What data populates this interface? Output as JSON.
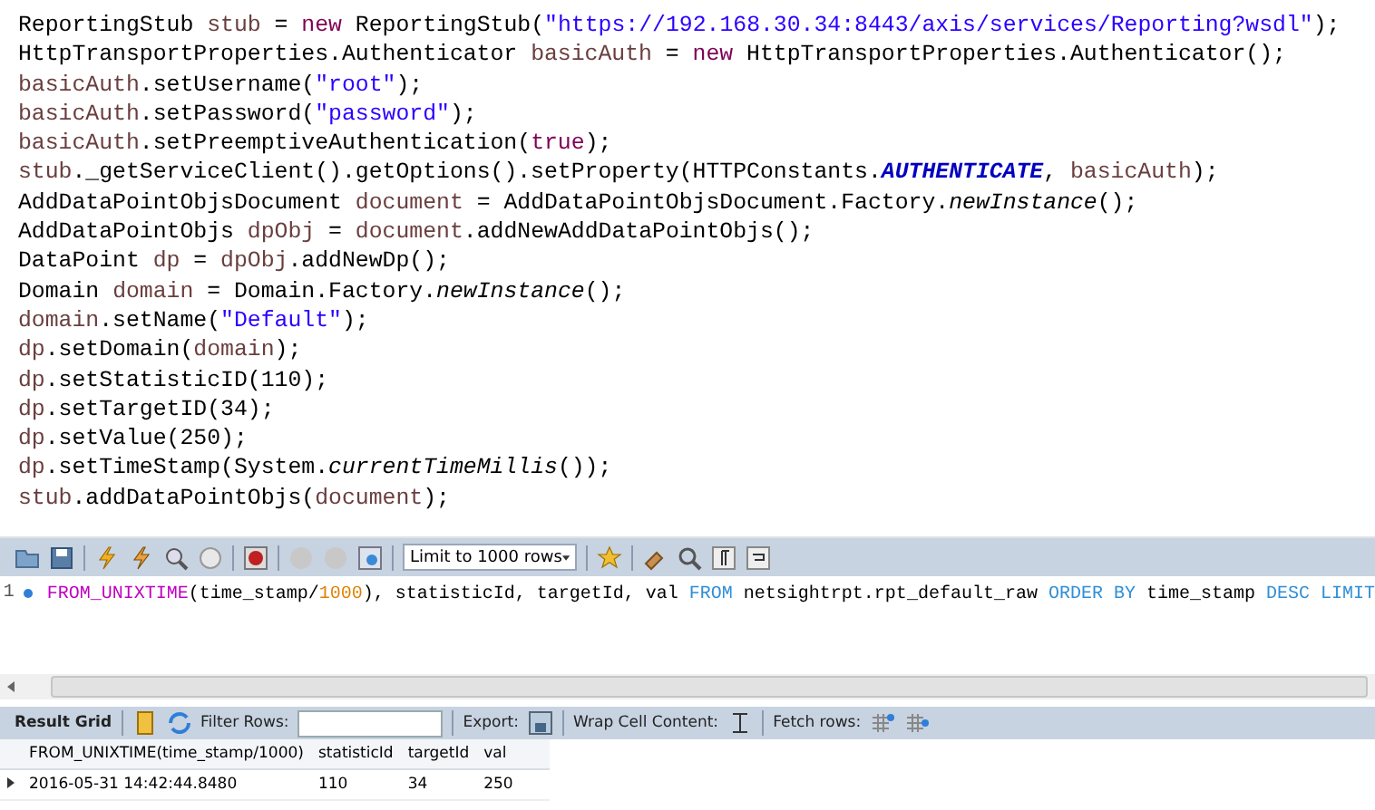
{
  "code_editor": {
    "lines": [
      [
        {
          "kind": "p",
          "text": "ReportingStub "
        },
        {
          "kind": "v",
          "text": "stub"
        },
        {
          "kind": "p",
          "text": " = "
        },
        {
          "kind": "k",
          "text": "new"
        },
        {
          "kind": "p",
          "text": " ReportingStub("
        },
        {
          "kind": "s",
          "text": "\"https://192.168.30.34:8443/axis/services/Reporting?wsdl\""
        },
        {
          "kind": "p",
          "text": ");"
        }
      ],
      [
        {
          "kind": "p",
          "text": "HttpTransportProperties.Authenticator "
        },
        {
          "kind": "v",
          "text": "basicAuth"
        },
        {
          "kind": "p",
          "text": " = "
        },
        {
          "kind": "k",
          "text": "new"
        },
        {
          "kind": "p",
          "text": " HttpTransportProperties.Authenticator();"
        }
      ],
      [
        {
          "kind": "v",
          "text": "basicAuth"
        },
        {
          "kind": "p",
          "text": ".setUsername("
        },
        {
          "kind": "s",
          "text": "\"root\""
        },
        {
          "kind": "p",
          "text": ");"
        }
      ],
      [
        {
          "kind": "v",
          "text": "basicAuth"
        },
        {
          "kind": "p",
          "text": ".setPassword("
        },
        {
          "kind": "s",
          "text": "\"password\""
        },
        {
          "kind": "p",
          "text": ");"
        }
      ],
      [
        {
          "kind": "v",
          "text": "basicAuth"
        },
        {
          "kind": "p",
          "text": ".setPreemptiveAuthentication("
        },
        {
          "kind": "k",
          "text": "true"
        },
        {
          "kind": "p",
          "text": ");"
        }
      ],
      [
        {
          "kind": "v",
          "text": "stub"
        },
        {
          "kind": "p",
          "text": "._getServiceClient().getOptions().setProperty(HTTPConstants."
        },
        {
          "kind": "c",
          "text": "AUTHENTICATE"
        },
        {
          "kind": "p",
          "text": ", "
        },
        {
          "kind": "v",
          "text": "basicAuth"
        },
        {
          "kind": "p",
          "text": ");"
        }
      ],
      [
        {
          "kind": "p",
          "text": "AddDataPointObjsDocument "
        },
        {
          "kind": "v",
          "text": "document"
        },
        {
          "kind": "p",
          "text": " = AddDataPointObjsDocument.Factory."
        },
        {
          "kind": "i",
          "text": "newInstance"
        },
        {
          "kind": "p",
          "text": "();"
        }
      ],
      [
        {
          "kind": "p",
          "text": "AddDataPointObjs "
        },
        {
          "kind": "v",
          "text": "dpObj"
        },
        {
          "kind": "p",
          "text": " = "
        },
        {
          "kind": "v",
          "text": "document"
        },
        {
          "kind": "p",
          "text": ".addNewAddDataPointObjs();"
        }
      ],
      [
        {
          "kind": "p",
          "text": "DataPoint "
        },
        {
          "kind": "v",
          "text": "dp"
        },
        {
          "kind": "p",
          "text": " = "
        },
        {
          "kind": "v",
          "text": "dpObj"
        },
        {
          "kind": "p",
          "text": ".addNewDp();"
        }
      ],
      [
        {
          "kind": "p",
          "text": "Domain "
        },
        {
          "kind": "v",
          "text": "domain"
        },
        {
          "kind": "p",
          "text": " = Domain.Factory."
        },
        {
          "kind": "i",
          "text": "newInstance"
        },
        {
          "kind": "p",
          "text": "();"
        }
      ],
      [
        {
          "kind": "v",
          "text": "domain"
        },
        {
          "kind": "p",
          "text": ".setName("
        },
        {
          "kind": "s",
          "text": "\"Default\""
        },
        {
          "kind": "p",
          "text": ");"
        }
      ],
      [
        {
          "kind": "v",
          "text": "dp"
        },
        {
          "kind": "p",
          "text": ".setDomain("
        },
        {
          "kind": "v",
          "text": "domain"
        },
        {
          "kind": "p",
          "text": ");"
        }
      ],
      [
        {
          "kind": "v",
          "text": "dp"
        },
        {
          "kind": "p",
          "text": ".setStatisticID(110);"
        }
      ],
      [
        {
          "kind": "v",
          "text": "dp"
        },
        {
          "kind": "p",
          "text": ".setTargetID(34);"
        }
      ],
      [
        {
          "kind": "v",
          "text": "dp"
        },
        {
          "kind": "p",
          "text": ".setValue(250);"
        }
      ],
      [
        {
          "kind": "v",
          "text": "dp"
        },
        {
          "kind": "p",
          "text": ".setTimeStamp(System."
        },
        {
          "kind": "i",
          "text": "currentTimeMillis"
        },
        {
          "kind": "p",
          "text": "());"
        }
      ],
      [
        {
          "kind": "v",
          "text": "stub"
        },
        {
          "kind": "p",
          "text": ".addDataPointObjs("
        },
        {
          "kind": "v",
          "text": "document"
        },
        {
          "kind": "p",
          "text": ");"
        }
      ]
    ]
  },
  "sql_editor": {
    "limit_select": "Limit to 1000 rows",
    "line_number": "1",
    "query": [
      {
        "kind": "f",
        "text": "FROM_UNIXTIME"
      },
      {
        "kind": "p",
        "text": "(time_stamp/"
      },
      {
        "kind": "n",
        "text": "1000"
      },
      {
        "kind": "p",
        "text": "), statisticId, targetId, val "
      },
      {
        "kind": "k",
        "text": "FROM"
      },
      {
        "kind": "p",
        "text": " netsightrpt.rpt_default_raw "
      },
      {
        "kind": "k",
        "text": "ORDER BY"
      },
      {
        "kind": "p",
        "text": " time_stamp "
      },
      {
        "kind": "k",
        "text": "DESC LIMIT"
      }
    ]
  },
  "result_panel": {
    "result_grid": "Result Grid",
    "filter_label": "Filter Rows:",
    "export_label": "Export:",
    "wrap_label": "Wrap Cell Content:",
    "fetch_label": "Fetch rows:",
    "columns": [
      "FROM_UNIXTIME(time_stamp/1000)",
      "statisticId",
      "targetId",
      "val"
    ],
    "rows": [
      [
        "2016-05-31 14:42:44.8480",
        "110",
        "34",
        "250"
      ]
    ]
  }
}
